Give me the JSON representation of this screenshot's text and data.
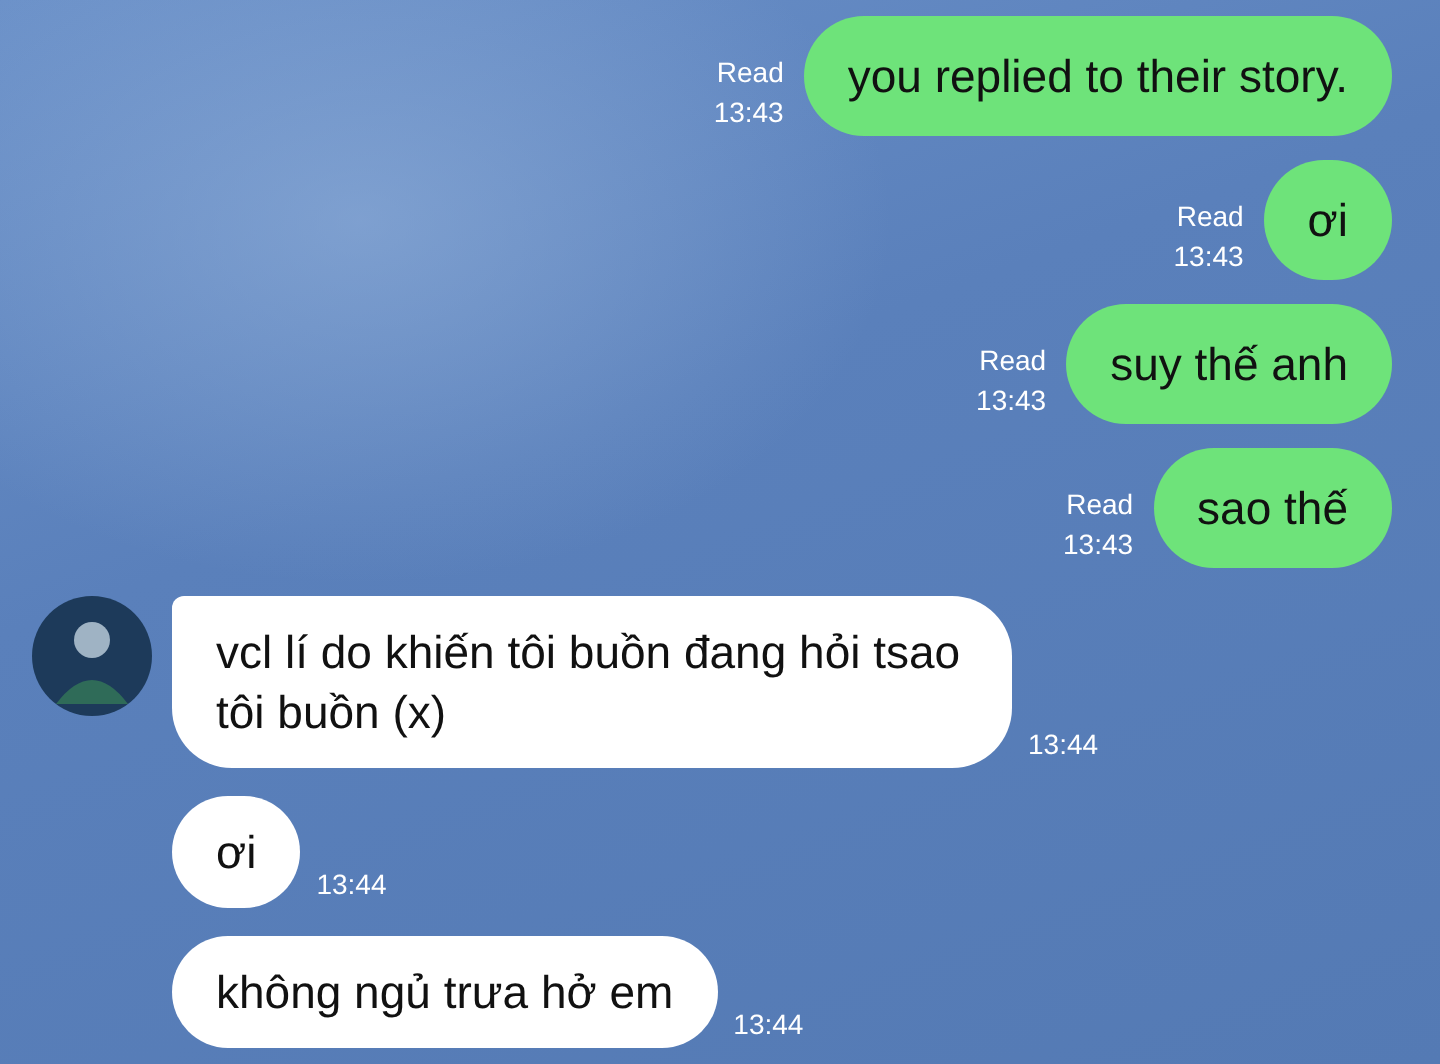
{
  "messages": [
    {
      "kind": "sent",
      "text": "you replied to their story.",
      "read": "Read",
      "time": "13:43"
    },
    {
      "kind": "sent",
      "text": "ơi",
      "read": "Read",
      "time": "13:43"
    },
    {
      "kind": "sent",
      "text": "suy thế anh",
      "read": "Read",
      "time": "13:43"
    },
    {
      "kind": "sent",
      "text": "sao thế",
      "read": "Read",
      "time": "13:43"
    },
    {
      "kind": "received",
      "avatar": true,
      "text": "vcl lí do khiến tôi buồn đang hỏi tsao tôi buồn (x)",
      "time": "13:44"
    },
    {
      "kind": "received",
      "avatar": false,
      "text": "ơi",
      "time": "13:44"
    },
    {
      "kind": "received",
      "avatar": false,
      "text": "không ngủ trưa hở em",
      "time": "13:44"
    }
  ]
}
